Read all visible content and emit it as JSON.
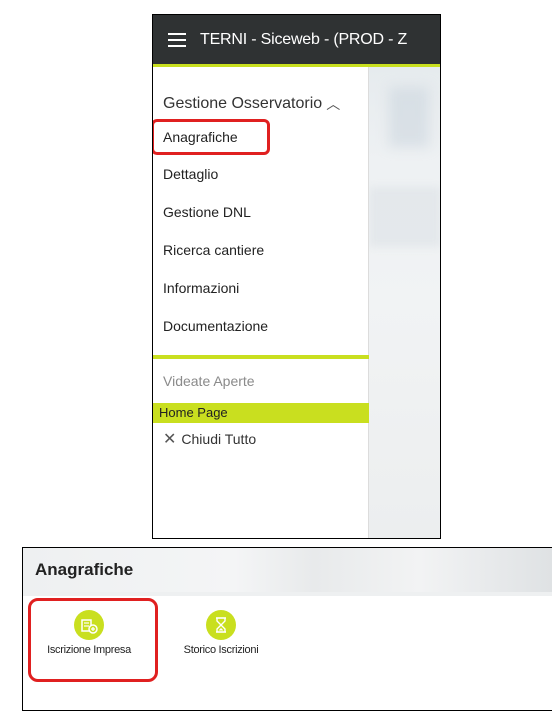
{
  "app": {
    "title": "TERNI - Siceweb - (PROD - Z"
  },
  "sidebar": {
    "group_header": "Gestione Osservatorio",
    "items": [
      {
        "label": "Anagrafiche"
      },
      {
        "label": "Dettaglio"
      },
      {
        "label": "Gestione DNL"
      },
      {
        "label": "Ricerca cantiere"
      },
      {
        "label": "Informazioni"
      },
      {
        "label": "Documentazione"
      }
    ],
    "open_views_label": "Videate Aperte",
    "open_views": [
      {
        "label": "Home Page"
      }
    ],
    "close_all_label": "Chiudi Tutto"
  },
  "anagrafiche_panel": {
    "title": "Anagrafiche",
    "tiles": [
      {
        "label": "Iscrizione Impresa",
        "icon": "add-company-icon"
      },
      {
        "label": "Storico Iscrizioni",
        "icon": "hourglass-icon"
      }
    ]
  },
  "colors": {
    "accent": "#c9df1f",
    "header_bg": "#2f3233",
    "highlight": "#e02020"
  }
}
